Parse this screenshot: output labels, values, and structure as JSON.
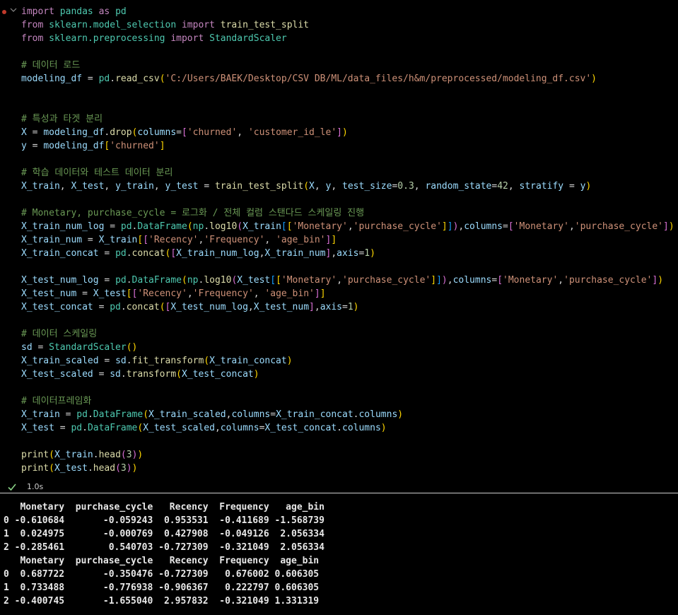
{
  "cell": {
    "lines": [
      [
        [
          "import",
          "kw"
        ],
        [
          " pandas ",
          "mod"
        ],
        [
          "as",
          "kw"
        ],
        [
          " pd",
          "mod"
        ]
      ],
      [
        [
          "from",
          "kw"
        ],
        [
          " sklearn.model_selection ",
          "mod"
        ],
        [
          "import",
          "kw"
        ],
        [
          " train_test_split",
          "fn"
        ]
      ],
      [
        [
          "from",
          "kw"
        ],
        [
          " sklearn.preprocessing ",
          "mod"
        ],
        [
          "import",
          "kw"
        ],
        [
          " StandardScaler",
          "cls"
        ]
      ],
      [],
      [
        [
          "# 데이터 로드",
          "cmt"
        ]
      ],
      [
        [
          "modeling_df",
          "var"
        ],
        [
          " = ",
          "pl"
        ],
        [
          "pd",
          "mod"
        ],
        [
          ".",
          "pl"
        ],
        [
          "read_csv",
          "fn"
        ],
        [
          "(",
          "br1"
        ],
        [
          "'C:/Users/BAEK/Desktop/CSV DB/ML/data_files/h&m/preprocessed/modeling_df.csv'",
          "str"
        ],
        [
          ")",
          "br1"
        ]
      ],
      [],
      [],
      [
        [
          "# 특성과 타겟 분리",
          "cmt"
        ]
      ],
      [
        [
          "X",
          "var"
        ],
        [
          " = ",
          "pl"
        ],
        [
          "modeling_df",
          "var"
        ],
        [
          ".",
          "pl"
        ],
        [
          "drop",
          "fn"
        ],
        [
          "(",
          "br1"
        ],
        [
          "columns",
          "var"
        ],
        [
          "=",
          "pl"
        ],
        [
          "[",
          "br2"
        ],
        [
          "'churned'",
          "str"
        ],
        [
          ", ",
          "pl"
        ],
        [
          "'customer_id_le'",
          "str"
        ],
        [
          "]",
          "br2"
        ],
        [
          ")",
          "br1"
        ]
      ],
      [
        [
          "y",
          "var"
        ],
        [
          " = ",
          "pl"
        ],
        [
          "modeling_df",
          "var"
        ],
        [
          "[",
          "br1"
        ],
        [
          "'churned'",
          "str"
        ],
        [
          "]",
          "br1"
        ]
      ],
      [],
      [
        [
          "# 학습 데이터와 테스트 데이터 분리",
          "cmt"
        ]
      ],
      [
        [
          "X_train",
          "var"
        ],
        [
          ", ",
          "pl"
        ],
        [
          "X_test",
          "var"
        ],
        [
          ", ",
          "pl"
        ],
        [
          "y_train",
          "var"
        ],
        [
          ", ",
          "pl"
        ],
        [
          "y_test",
          "var"
        ],
        [
          " = ",
          "pl"
        ],
        [
          "train_test_split",
          "fn"
        ],
        [
          "(",
          "br1"
        ],
        [
          "X",
          "var"
        ],
        [
          ", ",
          "pl"
        ],
        [
          "y",
          "var"
        ],
        [
          ", ",
          "pl"
        ],
        [
          "test_size",
          "var"
        ],
        [
          "=",
          "pl"
        ],
        [
          "0.3",
          "num"
        ],
        [
          ", ",
          "pl"
        ],
        [
          "random_state",
          "var"
        ],
        [
          "=",
          "pl"
        ],
        [
          "42",
          "num"
        ],
        [
          ", ",
          "pl"
        ],
        [
          "stratify",
          "var"
        ],
        [
          " = ",
          "pl"
        ],
        [
          "y",
          "var"
        ],
        [
          ")",
          "br1"
        ]
      ],
      [],
      [
        [
          "# Monetary, purchase_cycle = 로그화 / 전체 컬럼 스탠다드 스케일링 진행",
          "cmt"
        ]
      ],
      [
        [
          "X_train_num_log",
          "var"
        ],
        [
          " = ",
          "pl"
        ],
        [
          "pd",
          "mod"
        ],
        [
          ".",
          "pl"
        ],
        [
          "DataFrame",
          "cls"
        ],
        [
          "(",
          "br1"
        ],
        [
          "np",
          "mod"
        ],
        [
          ".",
          "pl"
        ],
        [
          "log10",
          "fn"
        ],
        [
          "(",
          "br2"
        ],
        [
          "X_train",
          "var"
        ],
        [
          "[",
          "br3"
        ],
        [
          "[",
          "br1"
        ],
        [
          "'Monetary'",
          "str"
        ],
        [
          ",",
          "pl"
        ],
        [
          "'purchase_cycle'",
          "str"
        ],
        [
          "]",
          "br1"
        ],
        [
          "]",
          "br3"
        ],
        [
          ")",
          "br2"
        ],
        [
          ",",
          "pl"
        ],
        [
          "columns",
          "var"
        ],
        [
          "=",
          "pl"
        ],
        [
          "[",
          "br2"
        ],
        [
          "'Monetary'",
          "str"
        ],
        [
          ",",
          "pl"
        ],
        [
          "'purchase_cycle'",
          "str"
        ],
        [
          "]",
          "br2"
        ],
        [
          ")",
          "br1"
        ]
      ],
      [
        [
          "X_train_num",
          "var"
        ],
        [
          " = ",
          "pl"
        ],
        [
          "X_train",
          "var"
        ],
        [
          "[",
          "br1"
        ],
        [
          "[",
          "br2"
        ],
        [
          "'Recency'",
          "str"
        ],
        [
          ",",
          "pl"
        ],
        [
          "'Frequency'",
          "str"
        ],
        [
          ", ",
          "pl"
        ],
        [
          "'age_bin'",
          "str"
        ],
        [
          "]",
          "br2"
        ],
        [
          "]",
          "br1"
        ]
      ],
      [
        [
          "X_train_concat",
          "var"
        ],
        [
          " = ",
          "pl"
        ],
        [
          "pd",
          "mod"
        ],
        [
          ".",
          "pl"
        ],
        [
          "concat",
          "fn"
        ],
        [
          "(",
          "br1"
        ],
        [
          "[",
          "br2"
        ],
        [
          "X_train_num_log",
          "var"
        ],
        [
          ",",
          "pl"
        ],
        [
          "X_train_num",
          "var"
        ],
        [
          "]",
          "br2"
        ],
        [
          ",",
          "pl"
        ],
        [
          "axis",
          "var"
        ],
        [
          "=",
          "pl"
        ],
        [
          "1",
          "num"
        ],
        [
          ")",
          "br1"
        ]
      ],
      [],
      [
        [
          "X_test_num_log",
          "var"
        ],
        [
          " = ",
          "pl"
        ],
        [
          "pd",
          "mod"
        ],
        [
          ".",
          "pl"
        ],
        [
          "DataFrame",
          "cls"
        ],
        [
          "(",
          "br1"
        ],
        [
          "np",
          "mod"
        ],
        [
          ".",
          "pl"
        ],
        [
          "log10",
          "fn"
        ],
        [
          "(",
          "br2"
        ],
        [
          "X_test",
          "var"
        ],
        [
          "[",
          "br3"
        ],
        [
          "[",
          "br1"
        ],
        [
          "'Monetary'",
          "str"
        ],
        [
          ",",
          "pl"
        ],
        [
          "'purchase_cycle'",
          "str"
        ],
        [
          "]",
          "br1"
        ],
        [
          "]",
          "br3"
        ],
        [
          ")",
          "br2"
        ],
        [
          ",",
          "pl"
        ],
        [
          "columns",
          "var"
        ],
        [
          "=",
          "pl"
        ],
        [
          "[",
          "br2"
        ],
        [
          "'Monetary'",
          "str"
        ],
        [
          ",",
          "pl"
        ],
        [
          "'purchase_cycle'",
          "str"
        ],
        [
          "]",
          "br2"
        ],
        [
          ")",
          "br1"
        ]
      ],
      [
        [
          "X_test_num",
          "var"
        ],
        [
          " = ",
          "pl"
        ],
        [
          "X_test",
          "var"
        ],
        [
          "[",
          "br1"
        ],
        [
          "[",
          "br2"
        ],
        [
          "'Recency'",
          "str"
        ],
        [
          ",",
          "pl"
        ],
        [
          "'Frequency'",
          "str"
        ],
        [
          ", ",
          "pl"
        ],
        [
          "'age_bin'",
          "str"
        ],
        [
          "]",
          "br2"
        ],
        [
          "]",
          "br1"
        ]
      ],
      [
        [
          "X_test_concat",
          "var"
        ],
        [
          " = ",
          "pl"
        ],
        [
          "pd",
          "mod"
        ],
        [
          ".",
          "pl"
        ],
        [
          "concat",
          "fn"
        ],
        [
          "(",
          "br1"
        ],
        [
          "[",
          "br2"
        ],
        [
          "X_test_num_log",
          "var"
        ],
        [
          ",",
          "pl"
        ],
        [
          "X_test_num",
          "var"
        ],
        [
          "]",
          "br2"
        ],
        [
          ",",
          "pl"
        ],
        [
          "axis",
          "var"
        ],
        [
          "=",
          "pl"
        ],
        [
          "1",
          "num"
        ],
        [
          ")",
          "br1"
        ]
      ],
      [],
      [
        [
          "# 데이터 스케일링",
          "cmt"
        ]
      ],
      [
        [
          "sd",
          "var"
        ],
        [
          " = ",
          "pl"
        ],
        [
          "StandardScaler",
          "cls"
        ],
        [
          "()",
          "br1"
        ]
      ],
      [
        [
          "X_train_scaled",
          "var"
        ],
        [
          " = ",
          "pl"
        ],
        [
          "sd",
          "var"
        ],
        [
          ".",
          "pl"
        ],
        [
          "fit_transform",
          "fn"
        ],
        [
          "(",
          "br1"
        ],
        [
          "X_train_concat",
          "var"
        ],
        [
          ")",
          "br1"
        ]
      ],
      [
        [
          "X_test_scaled",
          "var"
        ],
        [
          " = ",
          "pl"
        ],
        [
          "sd",
          "var"
        ],
        [
          ".",
          "pl"
        ],
        [
          "transform",
          "fn"
        ],
        [
          "(",
          "br1"
        ],
        [
          "X_test_concat",
          "var"
        ],
        [
          ")",
          "br1"
        ]
      ],
      [],
      [
        [
          "# 데이터프레임화",
          "cmt"
        ]
      ],
      [
        [
          "X_train",
          "var"
        ],
        [
          " = ",
          "pl"
        ],
        [
          "pd",
          "mod"
        ],
        [
          ".",
          "pl"
        ],
        [
          "DataFrame",
          "cls"
        ],
        [
          "(",
          "br1"
        ],
        [
          "X_train_scaled",
          "var"
        ],
        [
          ",",
          "pl"
        ],
        [
          "columns",
          "var"
        ],
        [
          "=",
          "pl"
        ],
        [
          "X_train_concat",
          "var"
        ],
        [
          ".",
          "pl"
        ],
        [
          "columns",
          "var"
        ],
        [
          ")",
          "br1"
        ]
      ],
      [
        [
          "X_test",
          "var"
        ],
        [
          " = ",
          "pl"
        ],
        [
          "pd",
          "mod"
        ],
        [
          ".",
          "pl"
        ],
        [
          "DataFrame",
          "cls"
        ],
        [
          "(",
          "br1"
        ],
        [
          "X_test_scaled",
          "var"
        ],
        [
          ",",
          "pl"
        ],
        [
          "columns",
          "var"
        ],
        [
          "=",
          "pl"
        ],
        [
          "X_test_concat",
          "var"
        ],
        [
          ".",
          "pl"
        ],
        [
          "columns",
          "var"
        ],
        [
          ")",
          "br1"
        ]
      ],
      [],
      [
        [
          "print",
          "fn"
        ],
        [
          "(",
          "br1"
        ],
        [
          "X_train",
          "var"
        ],
        [
          ".",
          "pl"
        ],
        [
          "head",
          "fn"
        ],
        [
          "(",
          "br2"
        ],
        [
          "3",
          "num"
        ],
        [
          ")",
          "br2"
        ],
        [
          ")",
          "br1"
        ]
      ],
      [
        [
          "print",
          "fn"
        ],
        [
          "(",
          "br1"
        ],
        [
          "X_test",
          "var"
        ],
        [
          ".",
          "pl"
        ],
        [
          "head",
          "fn"
        ],
        [
          "(",
          "br2"
        ],
        [
          "3",
          "num"
        ],
        [
          ")",
          "br2"
        ],
        [
          ")",
          "br1"
        ]
      ]
    ]
  },
  "status": {
    "time": "1.0s",
    "icon": "check-icon",
    "color": "#89d185"
  },
  "output": {
    "lines": [
      "   Monetary  purchase_cycle   Recency  Frequency   age_bin",
      "0 -0.610684       -0.059243  0.953531  -0.411689 -1.568739",
      "1  0.024975       -0.000769  0.427908  -0.049126  2.056334",
      "2 -0.285461        0.540703 -0.727309  -0.321049  2.056334",
      "   Monetary  purchase_cycle   Recency  Frequency  age_bin",
      "0  0.687722       -0.350476 -0.727309   0.676002 0.606305",
      "1  0.733488       -0.776938 -0.906367   0.222797 0.606305",
      "2 -0.400745       -1.655040  2.957832  -0.321049 1.331319"
    ]
  }
}
